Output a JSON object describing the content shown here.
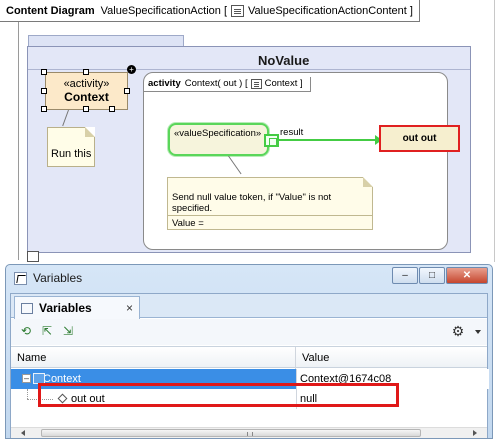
{
  "diagram": {
    "tab_type": "Content Diagram",
    "tab_name": "ValueSpecificationAction",
    "tab_bracket_open": "[",
    "tab_owner": "ValueSpecificationActionContent",
    "tab_bracket_close": "]",
    "outer_title": "NoValue",
    "context_action": {
      "stereotype": "«activity»",
      "name": "Context"
    },
    "note_run_this": "Run this",
    "inner_activity": {
      "keyword": "activity",
      "signature": "Context( out )",
      "bracket_open": "[",
      "owner": "Context",
      "bracket_close": "]"
    },
    "value_spec_action": {
      "stereotype": "«valueSpecification»"
    },
    "pin_label": "result",
    "out_node": "out out",
    "note_send_null": "Send null value token, if \"Value\" is not specified.",
    "note_value": "Value ="
  },
  "variables_window": {
    "title": "Variables",
    "buttons": {
      "minimize": "–",
      "maximize": "□",
      "close": "✕"
    },
    "tab": {
      "label": "Variables",
      "close": "×"
    },
    "toolbar_icons": [
      "refresh-icon",
      "export-icon",
      "import-icon",
      "gear-icon"
    ],
    "columns": {
      "name": "Name",
      "value": "Value"
    },
    "rows": [
      {
        "expander": "–",
        "name": "Context",
        "value": "Context@1674c08",
        "selected": true
      },
      {
        "name": "out out",
        "value": "null",
        "selected": false
      }
    ],
    "colors": {
      "selection": "#3a8ee6",
      "highlight": "#e01818",
      "flow": "#44cc44"
    }
  }
}
